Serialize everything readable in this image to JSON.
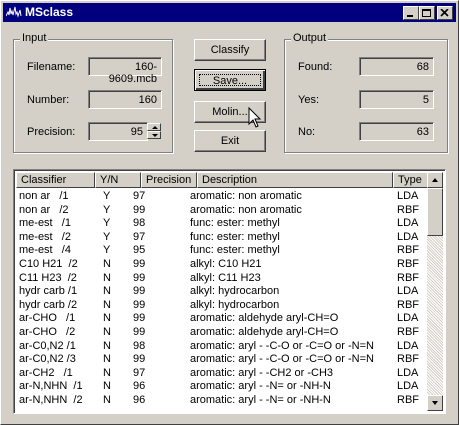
{
  "window": {
    "title": "MSclass"
  },
  "input": {
    "label": "Input",
    "filename_label": "Filename:",
    "filename_value": "160-9609.mcb",
    "number_label": "Number:",
    "number_value": "160",
    "precision_label": "Precision:",
    "precision_value": "95"
  },
  "buttons": {
    "classify": "Classify",
    "save": "Save...",
    "molin": "Molin...",
    "exit": "Exit"
  },
  "output": {
    "label": "Output",
    "found_label": "Found:",
    "found_value": "68",
    "yes_label": "Yes:",
    "yes_value": "5",
    "no_label": "No:",
    "no_value": "63"
  },
  "table": {
    "headers": [
      "Classifier",
      "Y/N",
      "Precision",
      "Description",
      "Type"
    ],
    "rows": [
      [
        "non ar   /1",
        "Y",
        "97",
        "aromatic: non aromatic",
        "LDA"
      ],
      [
        "non ar   /2",
        "Y",
        "99",
        "aromatic: non aromatic",
        "RBF"
      ],
      [
        "me-est   /1",
        "Y",
        "98",
        "func: ester: methyl",
        "LDA"
      ],
      [
        "me-est   /2",
        "Y",
        "97",
        "func: ester: methyl",
        "LDA"
      ],
      [
        "me-est   /4",
        "Y",
        "95",
        "func: ester: methyl",
        "RBF"
      ],
      [
        "C10 H21  /2",
        "N",
        "99",
        "alkyl: C10 H21",
        "RBF"
      ],
      [
        "C11 H23  /2",
        "N",
        "99",
        "alkyl: C11 H23",
        "RBF"
      ],
      [
        "hydr carb /1",
        "N",
        "99",
        "alkyl: hydrocarbon",
        "LDA"
      ],
      [
        "hydr carb /2",
        "N",
        "99",
        "alkyl: hydrocarbon",
        "RBF"
      ],
      [
        "ar-CHO   /1",
        "N",
        "99",
        "aromatic: aldehyde aryl-CH=O",
        "LDA"
      ],
      [
        "ar-CHO   /2",
        "N",
        "99",
        "aromatic: aldehyde aryl-CH=O",
        "RBF"
      ],
      [
        "ar-C0,N2 /1",
        "N",
        "98",
        "aromatic: aryl - -C-O or -C=O or -N=N",
        "LDA"
      ],
      [
        "ar-C0,N2 /3",
        "N",
        "99",
        "aromatic: aryl - -C-O or -C=O or -N=N",
        "RBF"
      ],
      [
        "ar-CH2   /1",
        "N",
        "97",
        "aromatic: aryl - -CH2 or -CH3",
        "LDA"
      ],
      [
        "ar-N,NHN  /1",
        "N",
        "96",
        "aromatic: aryl - -N= or -NH-N",
        "LDA"
      ],
      [
        "ar-N,NHN  /2",
        "N",
        "96",
        "aromatic: aryl - -N= or -NH-N",
        "RBF"
      ]
    ]
  }
}
